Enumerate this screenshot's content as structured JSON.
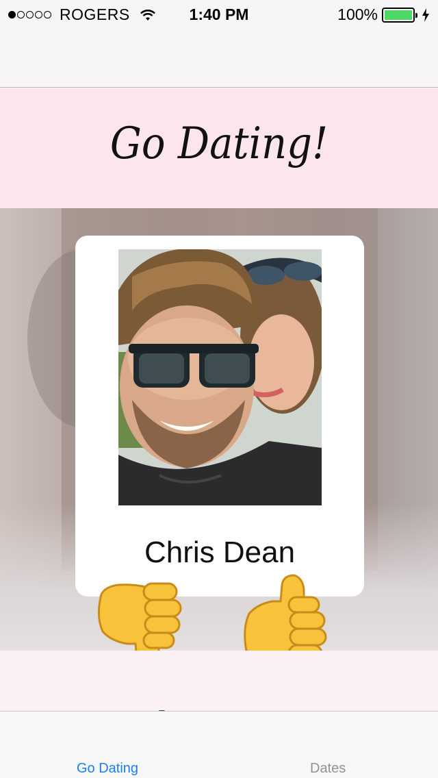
{
  "status_bar": {
    "carrier": "ROGERS",
    "time": "1:40 PM",
    "battery_percent": "100%",
    "signal_bars": 1,
    "signal_total": 5
  },
  "header": {
    "title": "Go Dating!"
  },
  "profile": {
    "name": "Chris Dean"
  },
  "swipe": {
    "dislike_icon": "thumbs-down-icon",
    "like_icon": "thumbs-up-icon"
  },
  "tab_bar": {
    "tabs": [
      {
        "label": "Go Dating",
        "active": true
      },
      {
        "label": "Dates",
        "active": false
      }
    ]
  },
  "colors": {
    "banner_bg": "#fde5ee",
    "tab_active": "#1a7ff0",
    "tab_inactive": "#929292",
    "battery": "#4cd964"
  }
}
